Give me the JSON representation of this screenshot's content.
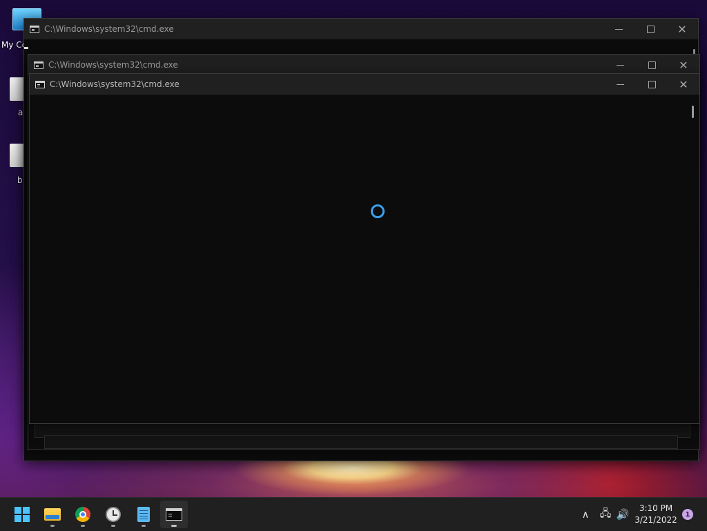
{
  "desktop": {
    "icons": [
      {
        "label": "My Co"
      },
      {
        "label": "a"
      },
      {
        "label": "b"
      }
    ]
  },
  "windows": [
    {
      "title": "C:\\Windows\\system32\\cmd.exe"
    },
    {
      "title": "C:\\Windows\\system32\\cmd.exe"
    },
    {
      "title": "C:\\Windows\\system32\\cmd.exe"
    }
  ],
  "controls": {
    "close_glyph": "✕"
  },
  "taskbar": {
    "apps": [
      "start-icon",
      "file-explorer-icon",
      "chrome-icon",
      "clock-app-icon",
      "notepad-icon",
      "command-prompt-icon"
    ],
    "tray": {
      "overflow_glyph": "∧",
      "network_glyph": "🖧",
      "volume_glyph": "🔊"
    },
    "time": "3:10 PM",
    "date": "3/21/2022",
    "notification_count": "1"
  },
  "colors": {
    "accent": "#4cc2ff",
    "spinner": "#3aa0f0",
    "titlebar": "#202020",
    "console": "#0c0c0c"
  }
}
